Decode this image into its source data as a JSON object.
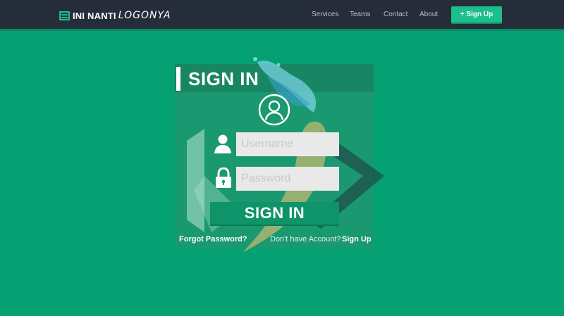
{
  "navbar": {
    "brand_bold": "INI NANTI",
    "brand_light": "LOGONYA",
    "links": [
      "Services",
      "Teams",
      "Contact",
      "About"
    ],
    "signup_label": "+ Sign Up"
  },
  "form": {
    "title": "SIGN IN",
    "username_placeholder": "Username",
    "password_placeholder": "Password",
    "submit_label": "SIGN IN",
    "forgot_label": "Forgot Password?",
    "account_text": "Don't have Account?",
    "signup_link": "Sign Up"
  },
  "icons": [
    "menu-icon",
    "avatar-icon",
    "user-icon",
    "lock-icon"
  ],
  "colors": {
    "background": "#05a173",
    "navbar": "#252c3a",
    "accent": "#1cbf8b",
    "input": "#e9e9e9"
  }
}
